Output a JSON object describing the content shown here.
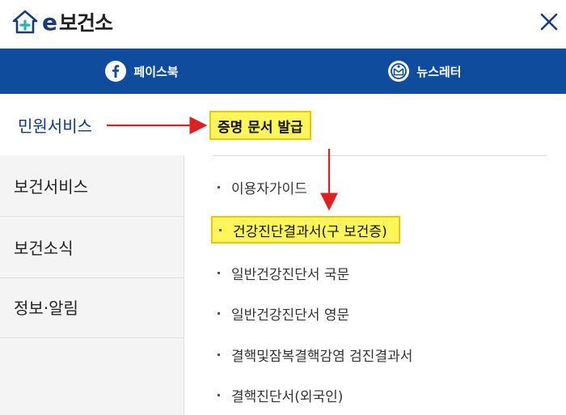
{
  "header": {
    "logo_e": "e",
    "logo_text": "보건소",
    "close_icon": "close-icon"
  },
  "social": {
    "facebook_label": "페이스북",
    "newsletter_label": "뉴스레터",
    "facebook_icon": "facebook-icon",
    "newsletter_icon": "newsletter-icon"
  },
  "sidebar": {
    "items": [
      {
        "label": "민원서비스",
        "active": true
      },
      {
        "label": "보건서비스",
        "active": false
      },
      {
        "label": "보건소식",
        "active": false
      },
      {
        "label": "정보·알림",
        "active": false
      }
    ]
  },
  "content": {
    "section_title": "증명 문서 발급",
    "sub_items": [
      {
        "label": "이용자가이드",
        "highlighted": false
      },
      {
        "label": "건강진단결과서(구 보건증)",
        "highlighted": true
      },
      {
        "label": "일반건강진단서 국문",
        "highlighted": false
      },
      {
        "label": "일반건강진단서 영문",
        "highlighted": false
      },
      {
        "label": "결핵및잠복결핵감염 검진결과서",
        "highlighted": false
      },
      {
        "label": "결핵진단서(외국인)",
        "highlighted": false
      }
    ]
  },
  "colors": {
    "brand_blue": "#0f4c9e",
    "highlight_yellow": "#fdf65a",
    "annotation_red": "#e02020"
  }
}
